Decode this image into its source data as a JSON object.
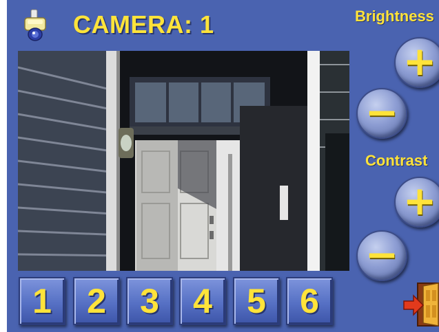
{
  "header": {
    "title": "CAMERA: 1",
    "camera_icon": "security-camera-icon"
  },
  "brightness": {
    "label": "Brightness",
    "increase": "+",
    "decrease": "−"
  },
  "contrast": {
    "label": "Contrast",
    "increase": "+",
    "decrease": "−"
  },
  "camera_buttons": [
    "1",
    "2",
    "3",
    "4",
    "5",
    "6"
  ],
  "exit": {
    "icon": "exit-door-icon"
  },
  "video": {
    "icon": "live-camera-feed"
  },
  "colors": {
    "background": "#4a63b0",
    "accent": "#ffe33a"
  }
}
